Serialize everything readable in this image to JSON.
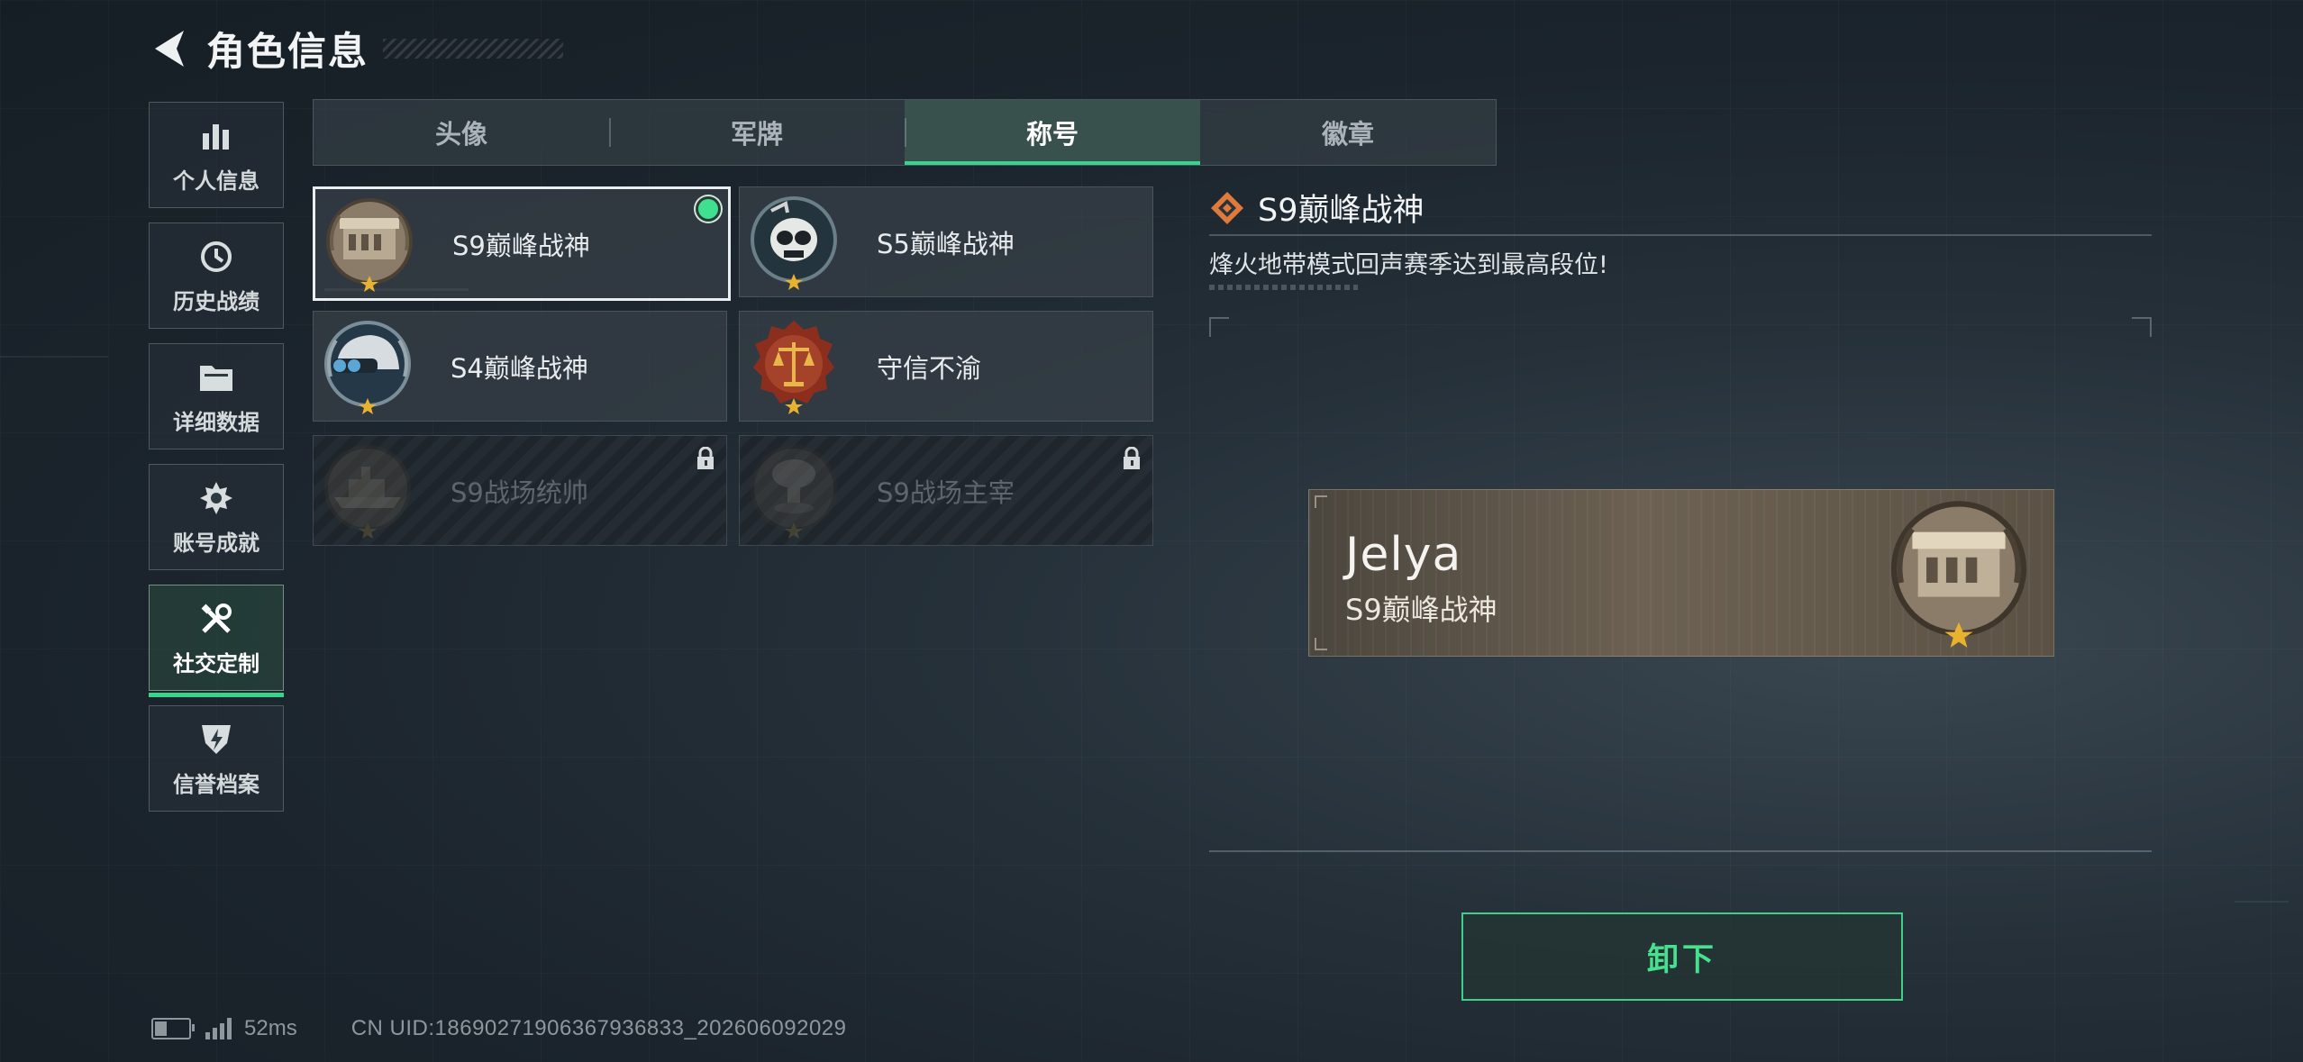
{
  "header": {
    "title": "角色信息",
    "back_icon": "back-arrow-icon"
  },
  "sidebar": {
    "items": [
      {
        "label": "个人信息",
        "icon": "bar-chart-icon",
        "active": false
      },
      {
        "label": "历史战绩",
        "icon": "clock-history-icon",
        "active": false
      },
      {
        "label": "详细数据",
        "icon": "folder-icon",
        "active": false
      },
      {
        "label": "账号成就",
        "icon": "achievement-icon",
        "active": false
      },
      {
        "label": "社交定制",
        "icon": "wrench-screwdriver-icon",
        "active": true
      },
      {
        "label": "信誉档案",
        "icon": "shield-bolt-icon",
        "active": false
      }
    ]
  },
  "tabs": [
    {
      "label": "头像",
      "active": false
    },
    {
      "label": "军牌",
      "active": false
    },
    {
      "label": "称号",
      "active": true
    },
    {
      "label": "徽章",
      "active": false
    }
  ],
  "titles": [
    {
      "name": "S9巅峰战神",
      "medal": "fortress-medal-icon",
      "selected": true,
      "equipped": true,
      "locked": false
    },
    {
      "name": "S5巅峰战神",
      "medal": "skull-medal-icon",
      "selected": false,
      "equipped": false,
      "locked": false
    },
    {
      "name": "S4巅峰战神",
      "medal": "helmet-medal-icon",
      "selected": false,
      "equipped": false,
      "locked": false
    },
    {
      "name": "守信不渝",
      "medal": "scales-medal-icon",
      "selected": false,
      "equipped": false,
      "locked": false
    },
    {
      "name": "S9战场统帅",
      "medal": "warship-medal-icon",
      "selected": false,
      "equipped": false,
      "locked": true
    },
    {
      "name": "S9战场主宰",
      "medal": "mushroom-cloud-medal-icon",
      "selected": false,
      "equipped": false,
      "locked": true
    }
  ],
  "detail": {
    "title": "S9巅峰战神",
    "title_icon": "diamond-rank-icon",
    "description": "烽火地带模式回声赛季达到最高段位!"
  },
  "preview": {
    "player_name": "Jelya",
    "title": "S9巅峰战神",
    "medal": "fortress-medal-icon"
  },
  "actions": {
    "unequip_label": "卸下"
  },
  "status_bar": {
    "battery_level": 0.35,
    "signal_bars": 4,
    "ping": "52ms",
    "uid": "CN UID:18690271906367936833_202606092029"
  },
  "colors": {
    "accent": "#37d48c",
    "button_text": "#47e08f",
    "rank_icon": "#e07a3a"
  }
}
